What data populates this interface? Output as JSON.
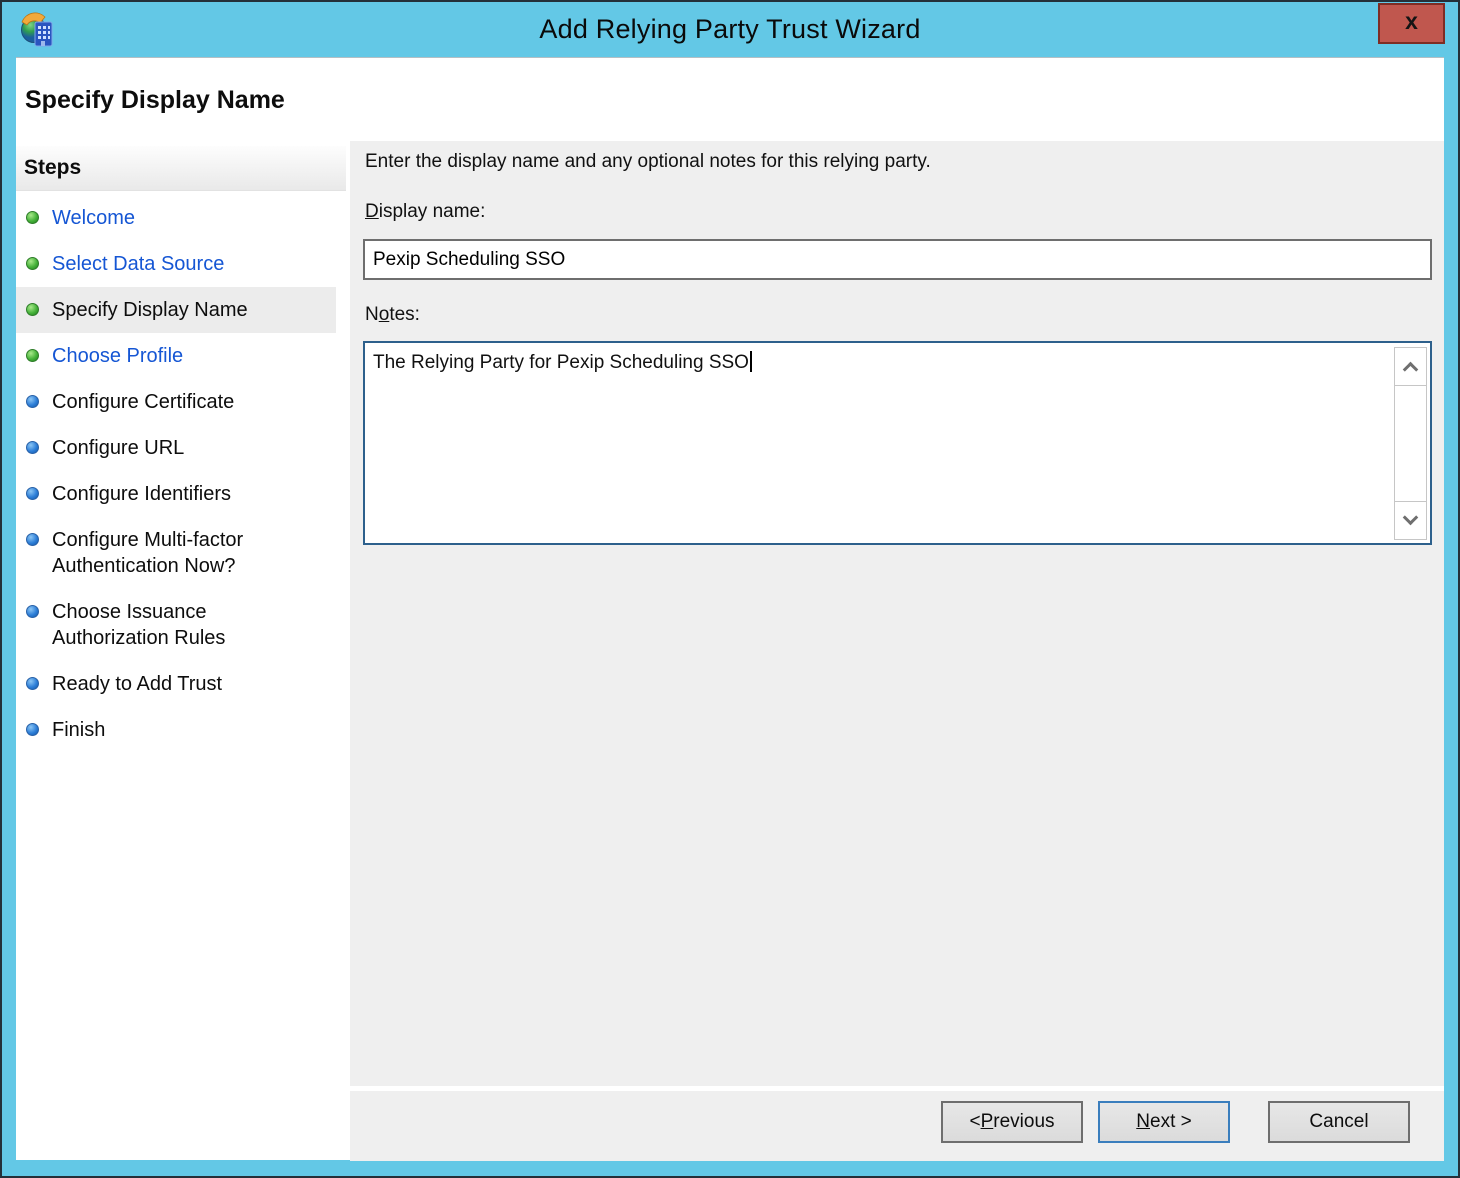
{
  "window": {
    "title": "Add Relying Party Trust Wizard",
    "close_button": "x"
  },
  "heading": "Specify Display Name",
  "steps": {
    "header": "Steps",
    "items": [
      {
        "label": "Welcome",
        "status": "completed-link"
      },
      {
        "label": "Select Data Source",
        "status": "completed-link"
      },
      {
        "label": "Specify Display Name",
        "status": "current"
      },
      {
        "label": "Choose Profile",
        "status": "completed-link"
      },
      {
        "label": "Configure Certificate",
        "status": "pending"
      },
      {
        "label": "Configure URL",
        "status": "pending"
      },
      {
        "label": "Configure Identifiers",
        "status": "pending"
      },
      {
        "label": "Configure Multi-factor Authentication Now?",
        "status": "pending"
      },
      {
        "label": "Choose Issuance Authorization Rules",
        "status": "pending"
      },
      {
        "label": "Ready to Add Trust",
        "status": "pending"
      },
      {
        "label": "Finish",
        "status": "pending"
      }
    ]
  },
  "content": {
    "instruction": "Enter the display name and any optional notes for this relying party.",
    "display_name": {
      "label": {
        "pre": "",
        "key": "D",
        "post": "isplay name:"
      },
      "value": "Pexip Scheduling SSO"
    },
    "notes": {
      "label": {
        "pre": "N",
        "key": "o",
        "post": "tes:"
      },
      "value": "The Relying Party for Pexip Scheduling SSO"
    }
  },
  "buttons": {
    "previous": {
      "pre": "< ",
      "key": "P",
      "post": "revious"
    },
    "next": {
      "pre": "",
      "key": "N",
      "post": "ext >"
    },
    "cancel": {
      "pre": "",
      "key": "",
      "post": "Cancel"
    }
  },
  "icons": {
    "app": "adfs-application-icon",
    "close": "close-x-icon",
    "scroll_up": "chevron-up-icon",
    "scroll_down": "chevron-down-icon",
    "completed_step": "green-orb-icon",
    "pending_step": "blue-orb-icon"
  },
  "colors": {
    "titlebar": "#63c8e6",
    "close_button": "#c0574e",
    "content_pane": "#efefef",
    "completed_bullet": "#3fae3f",
    "pending_bullet": "#2e7fd8",
    "link": "#1556d4",
    "focused_border": "#2d608c"
  }
}
